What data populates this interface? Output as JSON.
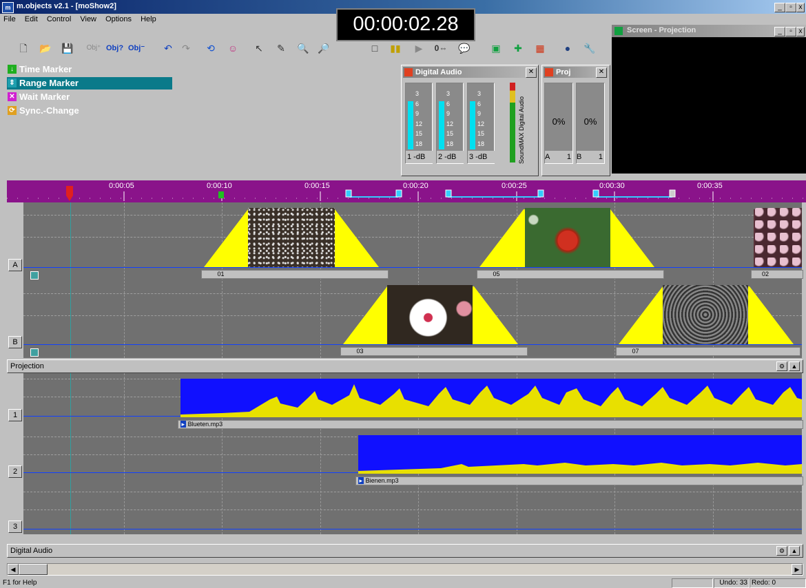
{
  "window": {
    "title": "m.objects v2.1 - [moShow2]",
    "icon": "app-icon",
    "controls": [
      "_",
      "ð",
      "×"
    ]
  },
  "menu": [
    {
      "label": "File",
      "accel": "F"
    },
    {
      "label": "Edit",
      "accel": "E"
    },
    {
      "label": "Control",
      "accel": "C"
    },
    {
      "label": "View",
      "accel": "V"
    },
    {
      "label": "Options",
      "accel": "p"
    },
    {
      "label": "Help",
      "accel": "H"
    }
  ],
  "timer": {
    "value": "00:00:02.28"
  },
  "toolbar": {
    "icons": [
      "new-icon",
      "open-icon",
      "save-icon",
      "obj-add-icon",
      "obj-query-icon",
      "obj-remove-icon",
      "undo-icon",
      "redo-icon",
      "loop-icon",
      "refresh-icon",
      "pick-icon",
      "pen-icon",
      "zoom-in-icon",
      "zoom-out-icon",
      "stop-icon",
      "pause-icon",
      "play-icon",
      "position-icon",
      "comment-icon",
      "screen-icon",
      "projector-icon",
      "grid-icon",
      "color-icon",
      "wrench-icon"
    ],
    "labels": {
      "obj1": "Obj",
      "obj2": "Obj",
      "obj3": "Obj",
      "pos": "0⇔"
    }
  },
  "markers": [
    {
      "label": "Time Marker",
      "color": "#1fae1f",
      "icon": "time-marker-icon",
      "glyph": "↓"
    },
    {
      "label": "Range Marker",
      "color": "#1f9fae",
      "icon": "range-marker-icon",
      "glyph": "⇕",
      "selected": true
    },
    {
      "label": "Wait Marker",
      "color": "#d020d0",
      "icon": "wait-marker-icon",
      "glyph": "✕"
    },
    {
      "label": "Sync.-Change",
      "color": "#e0a020",
      "icon": "sync-change-icon",
      "glyph": "⟳"
    }
  ],
  "digital_audio_panel": {
    "title": "Digital Audio",
    "scale": [
      "3",
      "6",
      "9",
      "12",
      "15",
      "18"
    ],
    "meters": [
      {
        "label": "1 -dB",
        "level": 0.78
      },
      {
        "label": "2 -dB",
        "level": 0.78
      },
      {
        "label": "3 -dB",
        "level": 0.78
      }
    ],
    "brand": "SoundMAX Digital Audio"
  },
  "proj_panel": {
    "title": "Proj",
    "boxes": [
      {
        "value": "0%",
        "label": "A",
        "num": "1"
      },
      {
        "value": "0%",
        "label": "B",
        "num": "1"
      }
    ]
  },
  "screen_panel": {
    "title": "Screen - Projection"
  },
  "timeline": {
    "labels": [
      "0:00:05",
      "0:00:10",
      "0:00:15",
      "0:00:20",
      "0:00:25",
      "0:00:30",
      "0:00:35"
    ]
  },
  "tracks": {
    "A": {
      "label": "A",
      "clips": [
        {
          "name": "01"
        },
        {
          "name": "05"
        },
        {
          "name": "02"
        }
      ]
    },
    "B": {
      "label": "B",
      "clips": [
        {
          "name": "03"
        },
        {
          "name": "07"
        }
      ]
    }
  },
  "sections": {
    "projection": "Projection",
    "digital_audio": "Digital Audio"
  },
  "audio_tracks": [
    {
      "label": "1",
      "file": "Blueten.mp3"
    },
    {
      "label": "2",
      "file": "Bienen.mp3"
    },
    {
      "label": "3",
      "file": ""
    }
  ],
  "status": {
    "help": "F1 for Help",
    "undo": "Undo: 33",
    "redo": "Redo: 0"
  },
  "colors": {
    "timeline": "#8a138a",
    "fade": "#ffff00",
    "audio_wave_bg": "#1010ff",
    "audio_wave": "#e8e000",
    "track_line": "#1040ff"
  }
}
